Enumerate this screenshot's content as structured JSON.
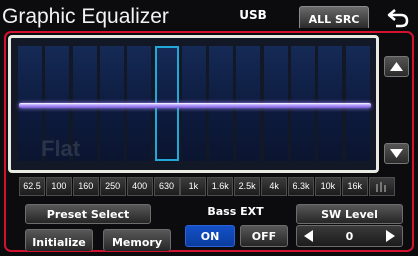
{
  "header": {
    "title": "Graphic Equalizer",
    "source": "USB",
    "all_src_label": "ALL SRC"
  },
  "graph": {
    "watermark": "Flat",
    "selected_band": "630",
    "curve": "flat",
    "accent_color": "#22a8d8",
    "curve_color": "#a88cff"
  },
  "bands": [
    "62.5",
    "100",
    "160",
    "250",
    "400",
    "630",
    "1k",
    "1.6k",
    "2.5k",
    "4k",
    "6.3k",
    "10k",
    "16k"
  ],
  "extra_band_icon": "bars-icon",
  "controls": {
    "preset_select": "Preset Select",
    "initialize": "Initialize",
    "memory": "Memory",
    "bass_ext_label": "Bass EXT",
    "bass_on": "ON",
    "bass_off": "OFF",
    "sw_level_label": "SW Level",
    "sw_level_value": "0"
  },
  "colors": {
    "frame": "#d2122f",
    "on_button": "#0a3d9e"
  }
}
